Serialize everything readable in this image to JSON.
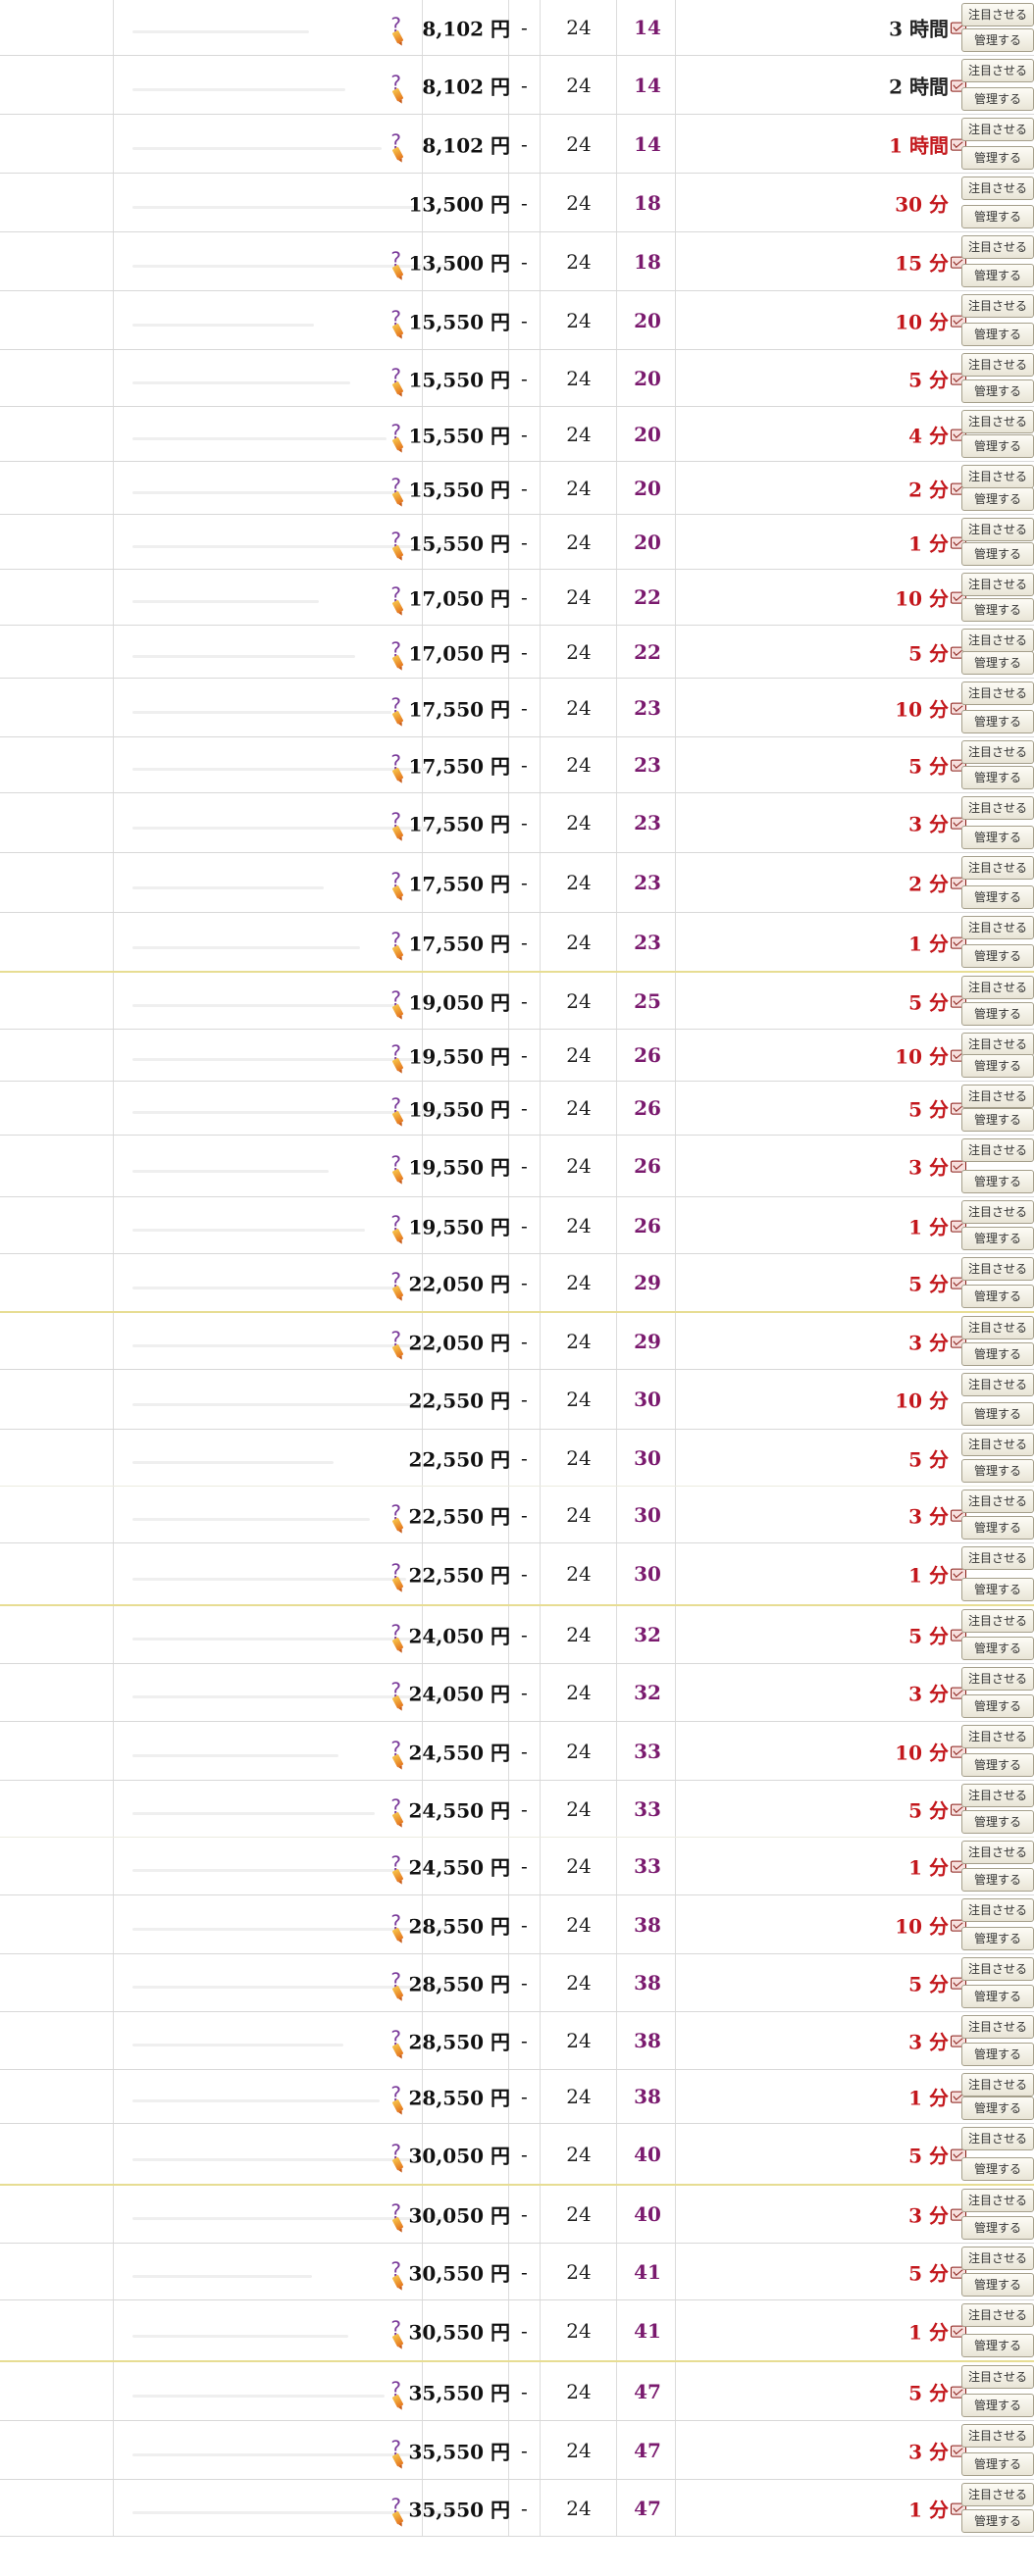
{
  "buttons": {
    "watch_label": "注目させる",
    "manage_label": "管理する"
  },
  "icons": {
    "help": "question-mark-icon",
    "edit": "pencil-icon",
    "notify": "notification-icon"
  },
  "colors": {
    "time_remaining": "#c3171c",
    "bids": "#7a1a6e",
    "help_icon": "#7a3a9a",
    "separator": "#e7dd93"
  },
  "rows": [
    {
      "price": "8,102 円",
      "dash": "-",
      "quantity": "24",
      "bids": "14",
      "time": "3 時間",
      "icon": true,
      "black": true
    },
    {
      "price": "8,102 円",
      "dash": "-",
      "quantity": "24",
      "bids": "14",
      "time": "2 時間",
      "icon": true,
      "black": true
    },
    {
      "price": "8,102 円",
      "dash": "-",
      "quantity": "24",
      "bids": "14",
      "time": "1 時間",
      "icon": true,
      "black": false
    },
    {
      "price": "13,500 円",
      "dash": "-",
      "quantity": "24",
      "bids": "18",
      "time": "30 分",
      "icon": false,
      "black": false
    },
    {
      "price": "13,500 円",
      "dash": "-",
      "quantity": "24",
      "bids": "18",
      "time": "15 分",
      "icon": true,
      "black": false
    },
    {
      "price": "15,550 円",
      "dash": "-",
      "quantity": "24",
      "bids": "20",
      "time": "10 分",
      "icon": true,
      "black": false
    },
    {
      "price": "15,550 円",
      "dash": "-",
      "quantity": "24",
      "bids": "20",
      "time": "5 分",
      "icon": true,
      "black": false
    },
    {
      "price": "15,550 円",
      "dash": "-",
      "quantity": "24",
      "bids": "20",
      "time": "4 分",
      "icon": true,
      "black": false
    },
    {
      "price": "15,550 円",
      "dash": "-",
      "quantity": "24",
      "bids": "20",
      "time": "2 分",
      "icon": true,
      "black": false
    },
    {
      "price": "15,550 円",
      "dash": "-",
      "quantity": "24",
      "bids": "20",
      "time": "1 分",
      "icon": true,
      "black": false
    },
    {
      "price": "17,050 円",
      "dash": "-",
      "quantity": "24",
      "bids": "22",
      "time": "10 分",
      "icon": true,
      "black": false
    },
    {
      "price": "17,050 円",
      "dash": "-",
      "quantity": "24",
      "bids": "22",
      "time": "5 分",
      "icon": true,
      "black": false
    },
    {
      "price": "17,550 円",
      "dash": "-",
      "quantity": "24",
      "bids": "23",
      "time": "10 分",
      "icon": true,
      "black": false
    },
    {
      "price": "17,550 円",
      "dash": "-",
      "quantity": "24",
      "bids": "23",
      "time": "5 分",
      "icon": true,
      "black": false
    },
    {
      "price": "17,550 円",
      "dash": "-",
      "quantity": "24",
      "bids": "23",
      "time": "3 分",
      "icon": true,
      "black": false
    },
    {
      "price": "17,550 円",
      "dash": "-",
      "quantity": "24",
      "bids": "23",
      "time": "2 分",
      "icon": true,
      "black": false
    },
    {
      "price": "17,550 円",
      "dash": "-",
      "quantity": "24",
      "bids": "23",
      "time": "1 分",
      "icon": true,
      "black": false
    },
    {
      "price": "19,050 円",
      "dash": "-",
      "quantity": "24",
      "bids": "25",
      "time": "5 分",
      "icon": true,
      "black": false
    },
    {
      "price": "19,550 円",
      "dash": "-",
      "quantity": "24",
      "bids": "26",
      "time": "10 分",
      "icon": true,
      "black": false
    },
    {
      "price": "19,550 円",
      "dash": "-",
      "quantity": "24",
      "bids": "26",
      "time": "5 分",
      "icon": true,
      "black": false
    },
    {
      "price": "19,550 円",
      "dash": "-",
      "quantity": "24",
      "bids": "26",
      "time": "3 分",
      "icon": true,
      "black": false
    },
    {
      "price": "19,550 円",
      "dash": "-",
      "quantity": "24",
      "bids": "26",
      "time": "1 分",
      "icon": true,
      "black": false
    },
    {
      "price": "22,050 円",
      "dash": "-",
      "quantity": "24",
      "bids": "29",
      "time": "5 分",
      "icon": true,
      "black": false
    },
    {
      "price": "22,050 円",
      "dash": "-",
      "quantity": "24",
      "bids": "29",
      "time": "3 分",
      "icon": true,
      "black": false
    },
    {
      "price": "22,550 円",
      "dash": "-",
      "quantity": "24",
      "bids": "30",
      "time": "10 分",
      "icon": false,
      "black": false
    },
    {
      "price": "22,550 円",
      "dash": "-",
      "quantity": "24",
      "bids": "30",
      "time": "5 分",
      "icon": false,
      "black": false
    },
    {
      "price": "22,550 円",
      "dash": "-",
      "quantity": "24",
      "bids": "30",
      "time": "3 分",
      "icon": true,
      "black": false
    },
    {
      "price": "22,550 円",
      "dash": "-",
      "quantity": "24",
      "bids": "30",
      "time": "1 分",
      "icon": true,
      "black": false
    },
    {
      "price": "24,050 円",
      "dash": "-",
      "quantity": "24",
      "bids": "32",
      "time": "5 分",
      "icon": true,
      "black": false
    },
    {
      "price": "24,050 円",
      "dash": "-",
      "quantity": "24",
      "bids": "32",
      "time": "3 分",
      "icon": true,
      "black": false
    },
    {
      "price": "24,550 円",
      "dash": "-",
      "quantity": "24",
      "bids": "33",
      "time": "10 分",
      "icon": true,
      "black": false
    },
    {
      "price": "24,550 円",
      "dash": "-",
      "quantity": "24",
      "bids": "33",
      "time": "5 分",
      "icon": true,
      "black": false
    },
    {
      "price": "24,550 円",
      "dash": "-",
      "quantity": "24",
      "bids": "33",
      "time": "1 分",
      "icon": true,
      "black": false
    },
    {
      "price": "28,550 円",
      "dash": "-",
      "quantity": "24",
      "bids": "38",
      "time": "10 分",
      "icon": true,
      "black": false
    },
    {
      "price": "28,550 円",
      "dash": "-",
      "quantity": "24",
      "bids": "38",
      "time": "5 分",
      "icon": true,
      "black": false
    },
    {
      "price": "28,550 円",
      "dash": "-",
      "quantity": "24",
      "bids": "38",
      "time": "3 分",
      "icon": true,
      "black": false
    },
    {
      "price": "28,550 円",
      "dash": "-",
      "quantity": "24",
      "bids": "38",
      "time": "1 分",
      "icon": true,
      "black": false
    },
    {
      "price": "30,050 円",
      "dash": "-",
      "quantity": "24",
      "bids": "40",
      "time": "5 分",
      "icon": true,
      "black": false
    },
    {
      "price": "30,050 円",
      "dash": "-",
      "quantity": "24",
      "bids": "40",
      "time": "3 分",
      "icon": true,
      "black": false
    },
    {
      "price": "30,550 円",
      "dash": "-",
      "quantity": "24",
      "bids": "41",
      "time": "5 分",
      "icon": true,
      "black": false
    },
    {
      "price": "30,550 円",
      "dash": "-",
      "quantity": "24",
      "bids": "41",
      "time": "1 分",
      "icon": true,
      "black": false
    },
    {
      "price": "35,550 円",
      "dash": "-",
      "quantity": "24",
      "bids": "47",
      "time": "5 分",
      "icon": true,
      "black": false
    },
    {
      "price": "35,550 円",
      "dash": "-",
      "quantity": "24",
      "bids": "47",
      "time": "3 分",
      "icon": true,
      "black": false
    },
    {
      "price": "35,550 円",
      "dash": "-",
      "quantity": "24",
      "bids": "47",
      "time": "1 分",
      "icon": true,
      "black": false
    }
  ]
}
